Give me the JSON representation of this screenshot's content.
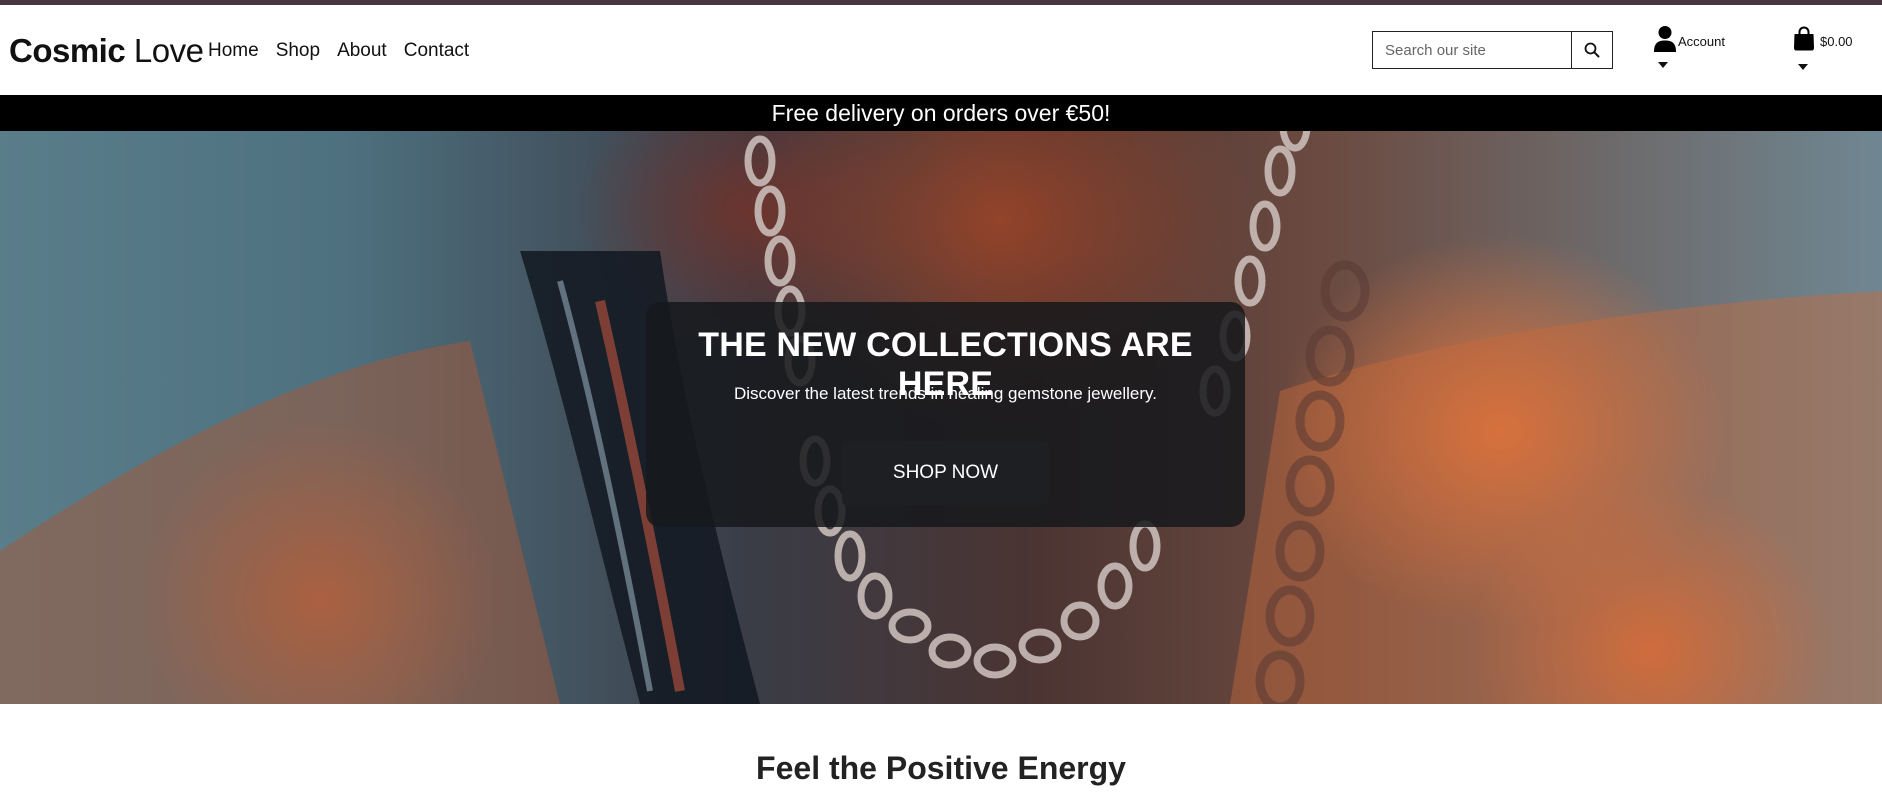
{
  "header": {
    "logo_bold": "Cosmic",
    "logo_light": "Love",
    "nav": [
      {
        "label": "Home"
      },
      {
        "label": "Shop"
      },
      {
        "label": "About"
      },
      {
        "label": "Contact"
      }
    ],
    "search": {
      "placeholder": "Search our site",
      "icon": "search-icon"
    },
    "account": {
      "label": "Account",
      "icon": "user-icon"
    },
    "cart": {
      "total": "$0.00",
      "icon": "shopping-bag-icon"
    }
  },
  "promo_banner": {
    "text": "Free delivery on orders over €50!"
  },
  "hero": {
    "title": "THE NEW COLLECTIONS ARE HERE",
    "subtitle": "Discover the latest trends in healing gemstone jewellery.",
    "cta_label": "SHOP NOW"
  },
  "section": {
    "title": "Feel the Positive Energy"
  },
  "colors": {
    "top_stripe": "#4a3640",
    "promo_bg": "#000000",
    "hero_card_bg": "#16181c",
    "hero_button_bg": "#1e1f23"
  }
}
